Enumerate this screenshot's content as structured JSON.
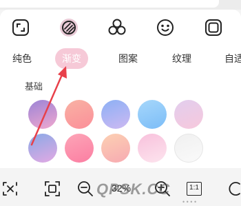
{
  "icon_toolbar": {
    "icons": [
      "crop-icon",
      "gradient-fill-icon",
      "three-circles-icon",
      "smiley-sticker-icon",
      "frame-icon"
    ]
  },
  "tabs": [
    {
      "label": "纯色",
      "active": false
    },
    {
      "label": "渐变",
      "active": true
    },
    {
      "label": "图案",
      "active": false
    },
    {
      "label": "纹理",
      "active": false
    },
    {
      "label": "自适",
      "active": false
    }
  ],
  "section": {
    "title": "基础"
  },
  "swatches": [
    {
      "from": "#9b84d6",
      "to": "#f0a8cf"
    },
    {
      "from": "#f8b2a4",
      "to": "#fc8f99"
    },
    {
      "from": "#8cb0f5",
      "to": "#cdb9f2"
    },
    {
      "from": "#a6d7fb",
      "to": "#7cbdf7"
    },
    {
      "from": "#e2ceee",
      "to": "#f7c8dc"
    },
    {
      "from": "#8aa9e6",
      "to": "#e3a9e3"
    },
    {
      "from": "#fda5b7",
      "to": "#fb7ea2"
    },
    {
      "from": "#fcd0b3",
      "to": "#f7aab1"
    },
    {
      "from": "#f8c1dc",
      "to": "#fde4ee"
    },
    {
      "from": "#f0f0f0",
      "to": "#fafafa"
    }
  ],
  "bottom_toolbar": {
    "icons": [
      "crop-rotate-icon",
      "fit-screen-icon",
      "zoom-out-icon",
      "zoom-in-icon",
      "original-size-icon",
      "rotate-icon"
    ],
    "zoom_level": "32%",
    "original_size_label": "1:1"
  },
  "watermark": {
    "text": "QPSK.CC",
    "dots": "• • • •"
  },
  "colors": {
    "accent": "#f6c9d7",
    "arrow": "#e8404a",
    "icon": "#222222"
  }
}
